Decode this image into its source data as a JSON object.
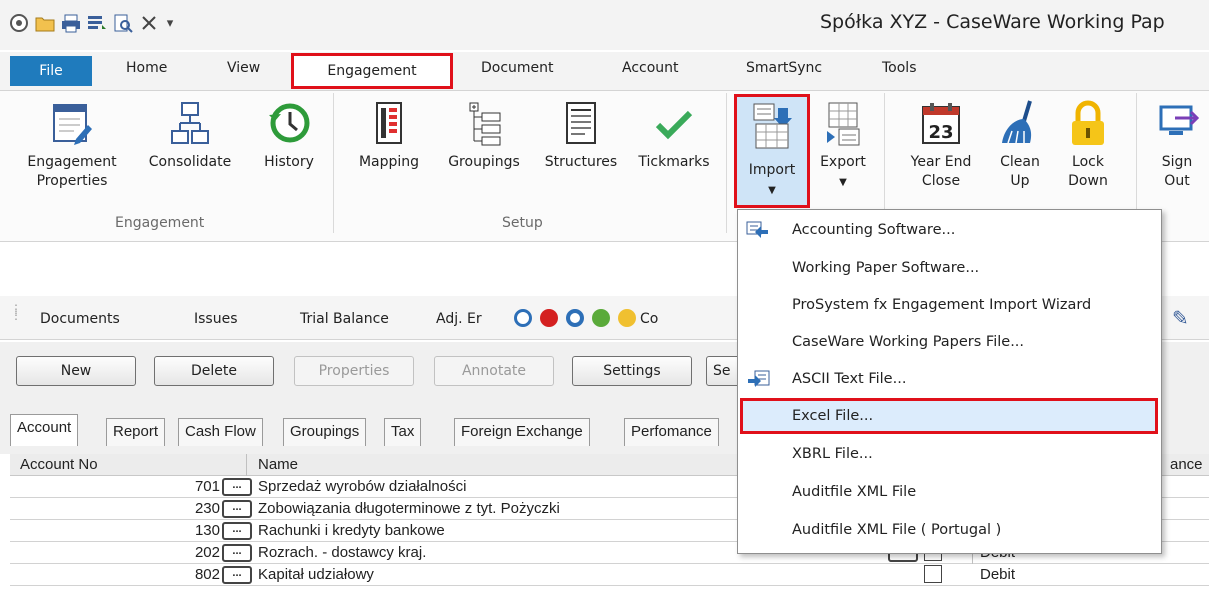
{
  "window": {
    "title": "Spółka XYZ - CaseWare Working Pap"
  },
  "qat": {
    "dropdown_glyph": "▾"
  },
  "tabs": {
    "file": "File",
    "home": "Home",
    "view": "View",
    "engagement": "Engagement",
    "document": "Document",
    "account": "Account",
    "smartsync": "SmartSync",
    "tools": "Tools"
  },
  "ribbon": {
    "engagement_properties_line1": "Engagement",
    "engagement_properties_line2": "Properties",
    "consolidate": "Consolidate",
    "history": "History",
    "group_engagement": "Engagement",
    "mapping": "Mapping",
    "groupings": "Groupings",
    "structures": "Structures",
    "tickmarks": "Tickmarks",
    "group_setup": "Setup",
    "import": "Import",
    "export": "Export",
    "year_end_line1": "Year End",
    "year_end_line2": "Close",
    "clean_line1": "Clean",
    "clean_line2": "Up",
    "lock_line1": "Lock",
    "lock_line2": "Down",
    "sign_line1": "Sign",
    "sign_line2": "Out",
    "calendar_day": "23"
  },
  "toolbar2": {
    "documents": "Documents",
    "issues": "Issues",
    "trial_balance": "Trial Balance",
    "adj": "Adj. Er",
    "co": "Co"
  },
  "buttons": {
    "new": "New",
    "delete": "Delete",
    "properties": "Properties",
    "annotate": "Annotate",
    "settings": "Settings",
    "se": "Se"
  },
  "sheet_tabs": [
    "Account",
    "Report",
    "Cash Flow",
    "Groupings",
    "Tax",
    "Foreign Exchange",
    "Perfomance"
  ],
  "grid": {
    "col_account_no": "Account No",
    "col_name": "Name",
    "col_balance_fragment": "ance",
    "rows": [
      {
        "acc": "701",
        "name": "Sprzedaż wyrobów działalności",
        "side": ""
      },
      {
        "acc": "230",
        "name": "Zobowiązania długoterminowe z tyt. Pożyczki",
        "side": ""
      },
      {
        "acc": "130",
        "name": "Rachunki i kredyty bankowe",
        "side": ""
      },
      {
        "acc": "202",
        "name": "Rozrach. - dostawcy kraj.",
        "side": "Debit"
      },
      {
        "acc": "802",
        "name": "Kapitał udziałowy",
        "side": "Debit"
      }
    ]
  },
  "import_menu": {
    "items": [
      "Accounting Software...",
      "Working Paper Software...",
      "ProSystem fx Engagement Import Wizard",
      "CaseWare Working Papers File...",
      "ASCII Text File...",
      "Excel File...",
      "XBRL File...",
      "Auditfile XML File",
      "Auditfile XML File ( Portugal )"
    ]
  },
  "colors": {
    "accent": "#1f7bbd",
    "highlight_border": "#e0101a",
    "menu_hover": "#dcecfc"
  }
}
